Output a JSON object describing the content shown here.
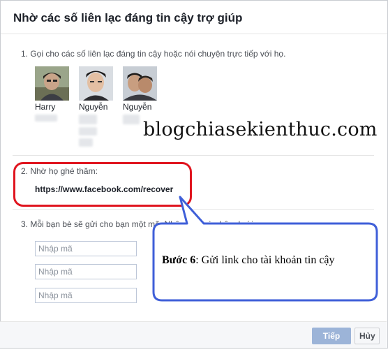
{
  "dialog": {
    "title": "Nhờ các số liên lạc đáng tin cậy trợ giúp"
  },
  "step1": {
    "text": "1. Gọi cho các số liên lạc đáng tin cậy hoặc nói chuyện trực tiếp với họ.",
    "contacts": [
      {
        "name": "Harry"
      },
      {
        "name": "Nguyễn"
      },
      {
        "name": "Nguyễn"
      }
    ]
  },
  "watermark": "blogchiasekienthuc.com",
  "step2": {
    "text": "2. Nhờ họ ghé thăm:",
    "link": "https://www.facebook.com/recover"
  },
  "step3": {
    "text": "3. Mỗi bạn bè sẽ gửi cho bạn một mã. Nhậ",
    "text_tail": "ã vào bên dưới:",
    "inputs": [
      {
        "placeholder": "Nhập mã"
      },
      {
        "placeholder": "Nhập mã"
      },
      {
        "placeholder": "Nhập mã"
      }
    ]
  },
  "callout": {
    "bold": "Bước 6",
    "rest": ": Gửi link cho tài khoản tin cậy"
  },
  "footer": {
    "continue_label": "Tiếp tục",
    "cancel_label": "Hủy"
  },
  "colors": {
    "highlight_red": "#e0151f",
    "callout_blue": "#3f5fd8",
    "primary_disabled": "#9cb4d8"
  }
}
